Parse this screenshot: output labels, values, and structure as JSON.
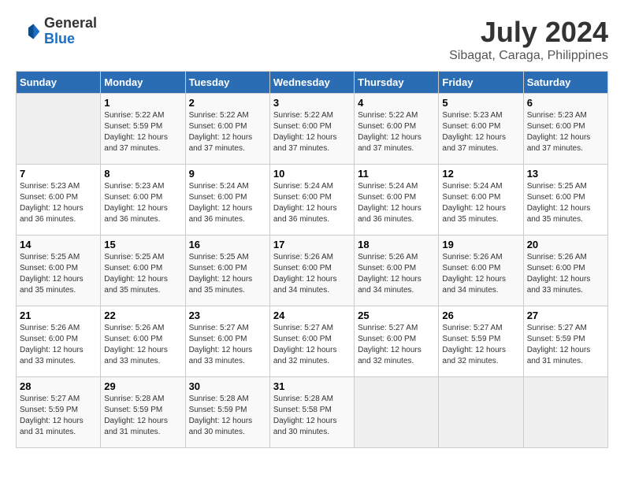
{
  "header": {
    "logo_text_general": "General",
    "logo_text_blue": "Blue",
    "title": "July 2024",
    "subtitle": "Sibagat, Caraga, Philippines"
  },
  "calendar": {
    "days_of_week": [
      "Sunday",
      "Monday",
      "Tuesday",
      "Wednesday",
      "Thursday",
      "Friday",
      "Saturday"
    ],
    "weeks": [
      [
        {
          "day": "",
          "info": ""
        },
        {
          "day": "1",
          "info": "Sunrise: 5:22 AM\nSunset: 5:59 PM\nDaylight: 12 hours\nand 37 minutes."
        },
        {
          "day": "2",
          "info": "Sunrise: 5:22 AM\nSunset: 6:00 PM\nDaylight: 12 hours\nand 37 minutes."
        },
        {
          "day": "3",
          "info": "Sunrise: 5:22 AM\nSunset: 6:00 PM\nDaylight: 12 hours\nand 37 minutes."
        },
        {
          "day": "4",
          "info": "Sunrise: 5:22 AM\nSunset: 6:00 PM\nDaylight: 12 hours\nand 37 minutes."
        },
        {
          "day": "5",
          "info": "Sunrise: 5:23 AM\nSunset: 6:00 PM\nDaylight: 12 hours\nand 37 minutes."
        },
        {
          "day": "6",
          "info": "Sunrise: 5:23 AM\nSunset: 6:00 PM\nDaylight: 12 hours\nand 37 minutes."
        }
      ],
      [
        {
          "day": "7",
          "info": "Sunrise: 5:23 AM\nSunset: 6:00 PM\nDaylight: 12 hours\nand 36 minutes."
        },
        {
          "day": "8",
          "info": "Sunrise: 5:23 AM\nSunset: 6:00 PM\nDaylight: 12 hours\nand 36 minutes."
        },
        {
          "day": "9",
          "info": "Sunrise: 5:24 AM\nSunset: 6:00 PM\nDaylight: 12 hours\nand 36 minutes."
        },
        {
          "day": "10",
          "info": "Sunrise: 5:24 AM\nSunset: 6:00 PM\nDaylight: 12 hours\nand 36 minutes."
        },
        {
          "day": "11",
          "info": "Sunrise: 5:24 AM\nSunset: 6:00 PM\nDaylight: 12 hours\nand 36 minutes."
        },
        {
          "day": "12",
          "info": "Sunrise: 5:24 AM\nSunset: 6:00 PM\nDaylight: 12 hours\nand 35 minutes."
        },
        {
          "day": "13",
          "info": "Sunrise: 5:25 AM\nSunset: 6:00 PM\nDaylight: 12 hours\nand 35 minutes."
        }
      ],
      [
        {
          "day": "14",
          "info": "Sunrise: 5:25 AM\nSunset: 6:00 PM\nDaylight: 12 hours\nand 35 minutes."
        },
        {
          "day": "15",
          "info": "Sunrise: 5:25 AM\nSunset: 6:00 PM\nDaylight: 12 hours\nand 35 minutes."
        },
        {
          "day": "16",
          "info": "Sunrise: 5:25 AM\nSunset: 6:00 PM\nDaylight: 12 hours\nand 35 minutes."
        },
        {
          "day": "17",
          "info": "Sunrise: 5:26 AM\nSunset: 6:00 PM\nDaylight: 12 hours\nand 34 minutes."
        },
        {
          "day": "18",
          "info": "Sunrise: 5:26 AM\nSunset: 6:00 PM\nDaylight: 12 hours\nand 34 minutes."
        },
        {
          "day": "19",
          "info": "Sunrise: 5:26 AM\nSunset: 6:00 PM\nDaylight: 12 hours\nand 34 minutes."
        },
        {
          "day": "20",
          "info": "Sunrise: 5:26 AM\nSunset: 6:00 PM\nDaylight: 12 hours\nand 33 minutes."
        }
      ],
      [
        {
          "day": "21",
          "info": "Sunrise: 5:26 AM\nSunset: 6:00 PM\nDaylight: 12 hours\nand 33 minutes."
        },
        {
          "day": "22",
          "info": "Sunrise: 5:26 AM\nSunset: 6:00 PM\nDaylight: 12 hours\nand 33 minutes."
        },
        {
          "day": "23",
          "info": "Sunrise: 5:27 AM\nSunset: 6:00 PM\nDaylight: 12 hours\nand 33 minutes."
        },
        {
          "day": "24",
          "info": "Sunrise: 5:27 AM\nSunset: 6:00 PM\nDaylight: 12 hours\nand 32 minutes."
        },
        {
          "day": "25",
          "info": "Sunrise: 5:27 AM\nSunset: 6:00 PM\nDaylight: 12 hours\nand 32 minutes."
        },
        {
          "day": "26",
          "info": "Sunrise: 5:27 AM\nSunset: 5:59 PM\nDaylight: 12 hours\nand 32 minutes."
        },
        {
          "day": "27",
          "info": "Sunrise: 5:27 AM\nSunset: 5:59 PM\nDaylight: 12 hours\nand 31 minutes."
        }
      ],
      [
        {
          "day": "28",
          "info": "Sunrise: 5:27 AM\nSunset: 5:59 PM\nDaylight: 12 hours\nand 31 minutes."
        },
        {
          "day": "29",
          "info": "Sunrise: 5:28 AM\nSunset: 5:59 PM\nDaylight: 12 hours\nand 31 minutes."
        },
        {
          "day": "30",
          "info": "Sunrise: 5:28 AM\nSunset: 5:59 PM\nDaylight: 12 hours\nand 30 minutes."
        },
        {
          "day": "31",
          "info": "Sunrise: 5:28 AM\nSunset: 5:58 PM\nDaylight: 12 hours\nand 30 minutes."
        },
        {
          "day": "",
          "info": ""
        },
        {
          "day": "",
          "info": ""
        },
        {
          "day": "",
          "info": ""
        }
      ]
    ]
  }
}
